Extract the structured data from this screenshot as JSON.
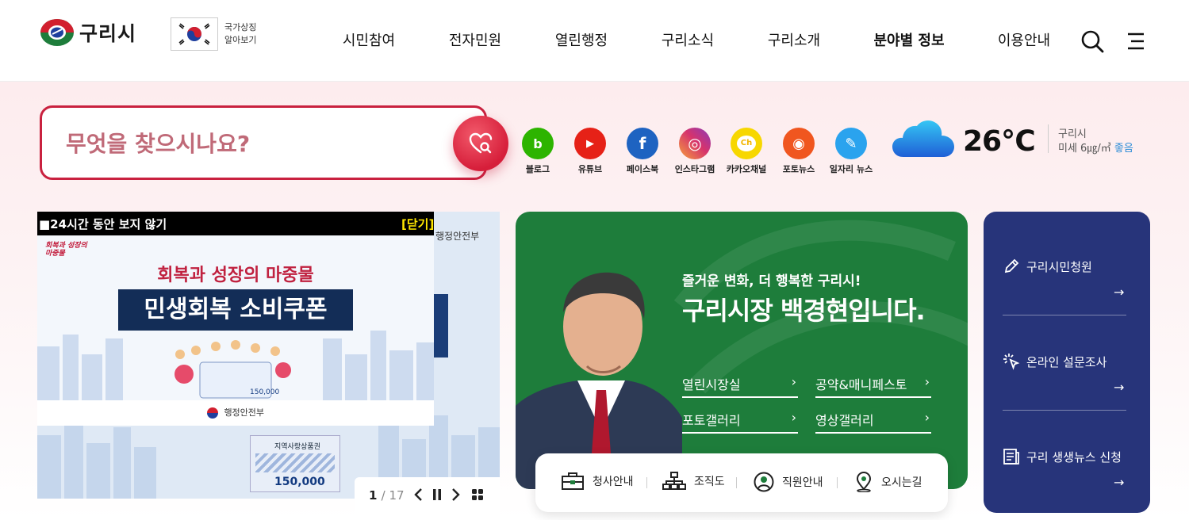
{
  "header": {
    "logo_text": "구리시",
    "symbol_text_1": "국가상징",
    "symbol_text_2": "알아보기",
    "nav": [
      "시민참여",
      "전자민원",
      "열린행정",
      "구리소식",
      "구리소개",
      "분야별 정보",
      "이용안내"
    ],
    "nav_bold_index": 5
  },
  "search": {
    "placeholder": "무엇을 찾으시나요?"
  },
  "sns": [
    {
      "label": "블로그",
      "glyph": "b",
      "color": "#2db400",
      "icon": "blog-icon"
    },
    {
      "label": "유튜브",
      "glyph": "▶",
      "color": "#e62117",
      "icon": "youtube-icon"
    },
    {
      "label": "페이스북",
      "glyph": "f",
      "color": "#1e63c1",
      "icon": "facebook-icon"
    },
    {
      "label": "인스타그램",
      "glyph": "◎",
      "color": "#d6336c",
      "icon": "instagram-icon"
    },
    {
      "label": "카카오채널",
      "glyph": "Ch",
      "color": "#f7d700",
      "icon": "kakao-channel-icon"
    },
    {
      "label": "포토뉴스",
      "glyph": "◉",
      "color": "#f0561f",
      "icon": "camera-icon"
    },
    {
      "label": "일자리 뉴스",
      "glyph": "✎",
      "color": "#2aa3ee",
      "icon": "job-news-icon"
    }
  ],
  "weather": {
    "temp": "26℃",
    "city": "구리시",
    "dust_label": "미세 6㎍/㎥",
    "dust_status": "좋음"
  },
  "banner": {
    "hide_24h": "■24시간 동안 보지 않기",
    "close": "[닫기]",
    "ministry": "행정안전부",
    "badge": "회복과 성장의 마중물",
    "title1": "회복과 성장의 마중물",
    "title2": "민생회복 소비쿠폰",
    "footer": "행정안전부",
    "coupon_title": "지역사랑상품권",
    "coupon_amount": "150,000",
    "card_amount": "150,000",
    "page_current": "1",
    "page_total": "/ 17"
  },
  "mayor": {
    "subtitle": "즐거운 변화, 더 행복한 구리시!",
    "title": "구리시장 백경현입니다.",
    "links": [
      "열린시장실",
      "공약&매니페스토",
      "포토갤러리",
      "영상갤러리"
    ],
    "bar": [
      "청사안내",
      "조직도",
      "직원안내",
      "오시는길"
    ]
  },
  "quick": [
    {
      "label": "구리시민청원",
      "icon": "pencil-icon"
    },
    {
      "label": "온라인 설문조사",
      "icon": "click-icon"
    },
    {
      "label": "구리 생생뉴스 신청",
      "icon": "news-icon"
    }
  ],
  "colors": {
    "accent_red": "#c9213f",
    "mayor_green": "#1e7d3b",
    "quick_navy": "#27347a"
  }
}
